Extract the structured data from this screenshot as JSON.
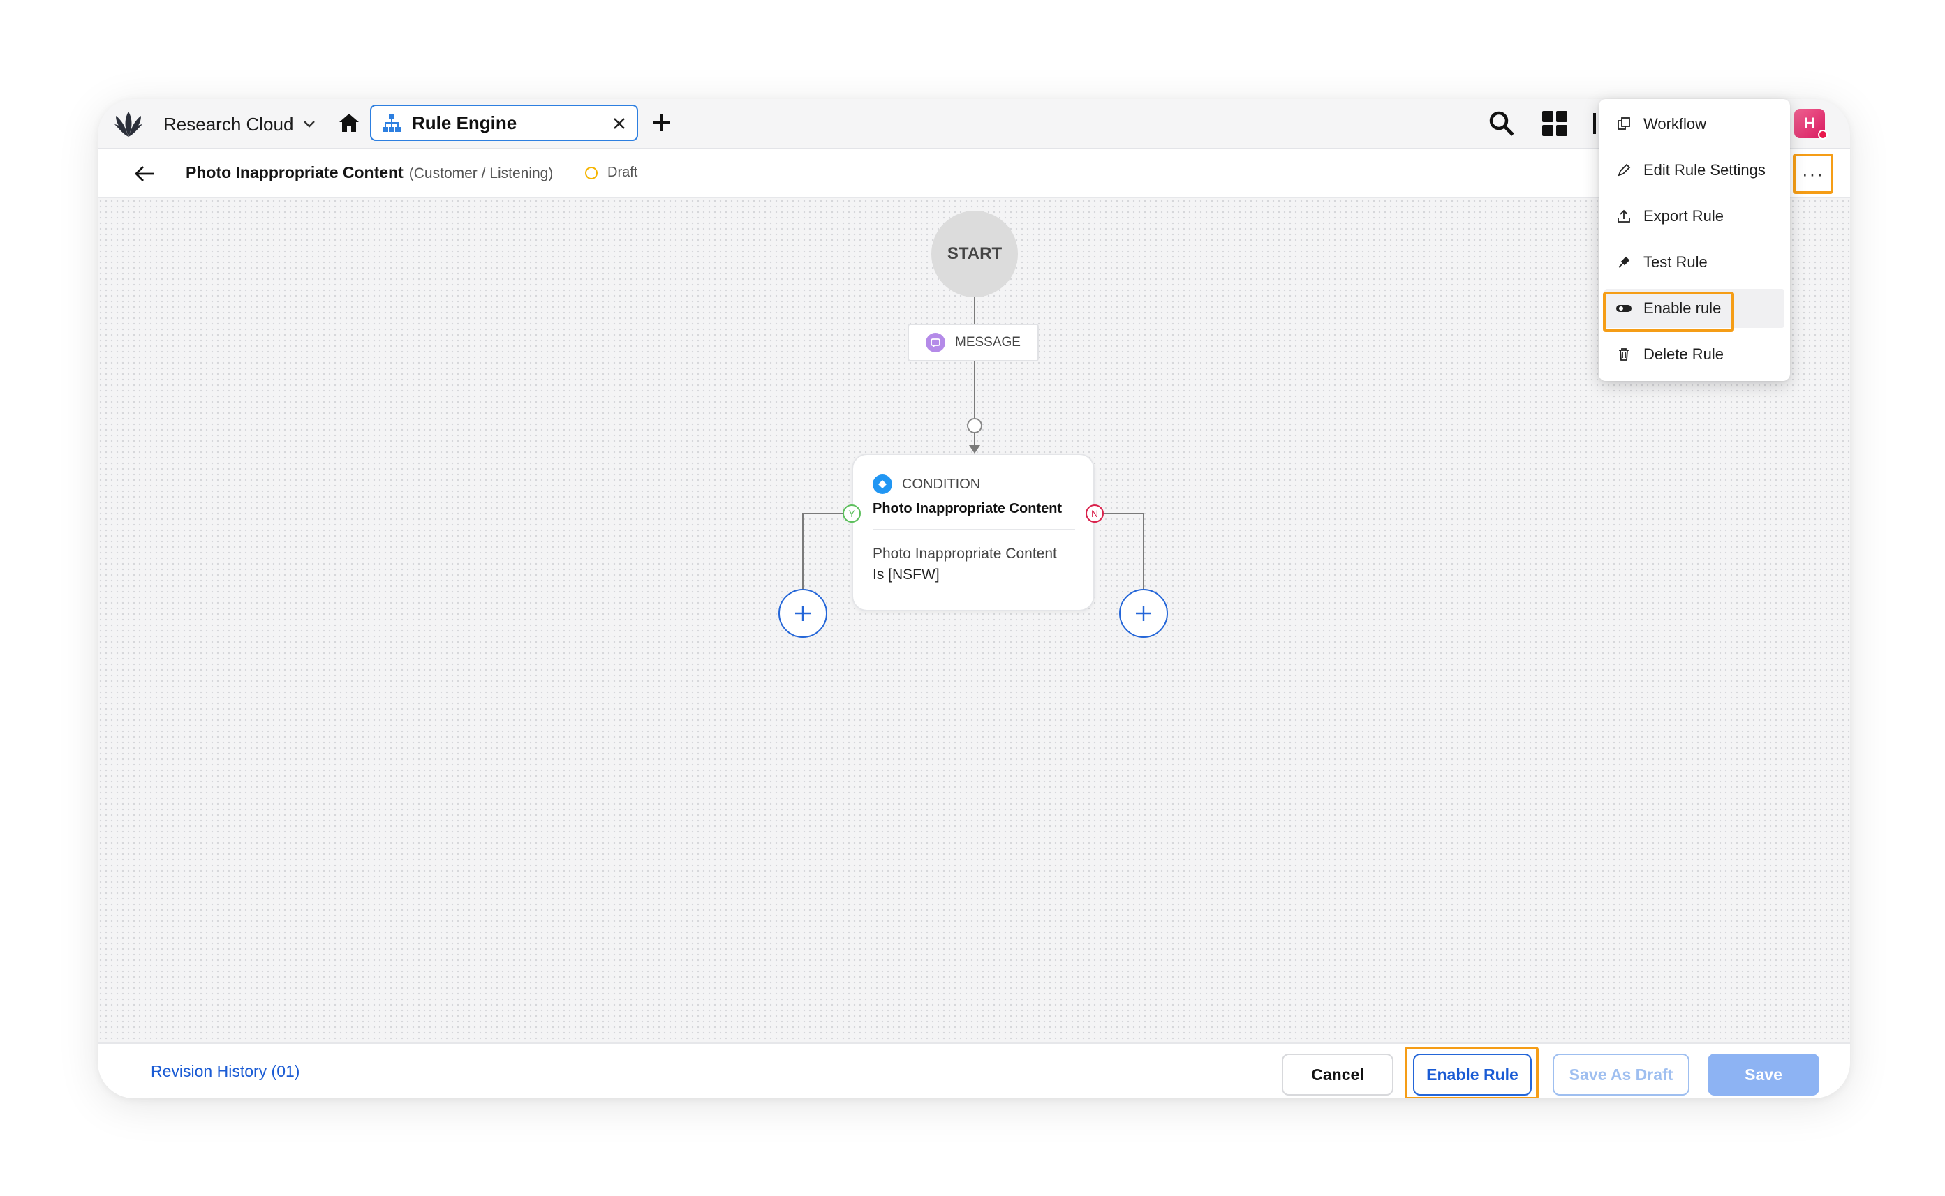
{
  "topbar": {
    "workspace": "Research Cloud",
    "tab_label": "Rule Engine",
    "avatar_initial": "H"
  },
  "subheader": {
    "rule_name": "Photo Inappropriate Content",
    "rule_path": "(Customer / Listening)",
    "status": "Draft",
    "more_label": "···"
  },
  "flow": {
    "start_label": "START",
    "message_label": "MESSAGE",
    "condition": {
      "type_label": "CONDITION",
      "title": "Photo Inappropriate Content",
      "detail_line1": "Photo Inappropriate Content",
      "detail_line2": "Is [NSFW]"
    },
    "yes_label": "Y",
    "no_label": "N"
  },
  "menu": {
    "items": [
      {
        "label": "Workflow",
        "icon": "workflow-icon"
      },
      {
        "label": "Edit Rule Settings",
        "icon": "edit-icon"
      },
      {
        "label": "Export Rule",
        "icon": "export-icon"
      },
      {
        "label": "Test Rule",
        "icon": "test-icon"
      },
      {
        "label": "Enable rule",
        "icon": "toggle-icon"
      },
      {
        "label": "Delete Rule",
        "icon": "trash-icon"
      }
    ]
  },
  "footer": {
    "revision": "Revision History (01)",
    "cancel": "Cancel",
    "enable": "Enable Rule",
    "save_draft": "Save As Draft",
    "save": "Save"
  },
  "help_label": "!",
  "colors": {
    "accent": "#2466d8",
    "highlight": "#f59d16",
    "draft": "#f5b400",
    "save_disabled": "#8db3f3"
  }
}
